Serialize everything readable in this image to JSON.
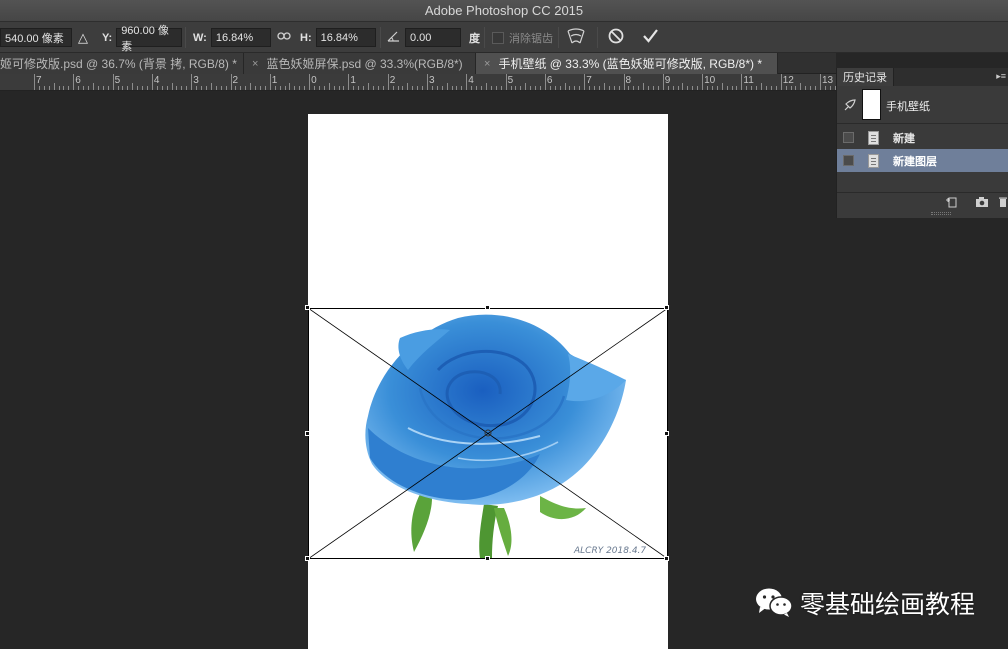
{
  "window": {
    "title": "Adobe Photoshop CC 2015"
  },
  "options": {
    "x_value": "540.00 像素",
    "delta_label": "△",
    "y_label": "Y:",
    "y_value": "960.00 像素",
    "w_label": "W:",
    "w_value": "16.84%",
    "h_label": "H:",
    "h_value": "16.84%",
    "angle_value": "0.00",
    "angle_unit": "度",
    "antialias_label": "消除锯齿",
    "warp_icon": "warp-icon",
    "cancel_icon": "cancel-transform-icon",
    "commit_icon": "commit-checkmark-icon"
  },
  "tabs": [
    {
      "label": "姬可修改版.psd @ 36.7% (背景 拷, RGB/8) *",
      "closable": false,
      "active": false
    },
    {
      "label": "蓝色妖姬屏保.psd @ 33.3%(RGB/8*)",
      "closable": true,
      "active": false
    },
    {
      "label": "手机壁纸 @ 33.3% (蓝色妖姬可修改版, RGB/8*) *",
      "closable": true,
      "active": true
    }
  ],
  "tab_close_glyph": "×",
  "ruler": {
    "labels": [
      "7",
      "6",
      "5",
      "4",
      "3",
      "2",
      "1",
      "0",
      "1",
      "2",
      "3",
      "4",
      "5",
      "6",
      "7",
      "8",
      "9",
      "10",
      "11",
      "12",
      "13"
    ]
  },
  "history": {
    "panel_title": "历史记录",
    "snapshot_label": "手机壁纸",
    "items": [
      {
        "label": "新建",
        "selected": false
      },
      {
        "label": "新建图层",
        "selected": true
      }
    ]
  },
  "watermark": {
    "text": "零基础绘画教程"
  },
  "colors": {
    "selected_row": "#6f7f9a",
    "rose_blue": "#3a8fd8",
    "stem_green": "#5aa33a"
  }
}
